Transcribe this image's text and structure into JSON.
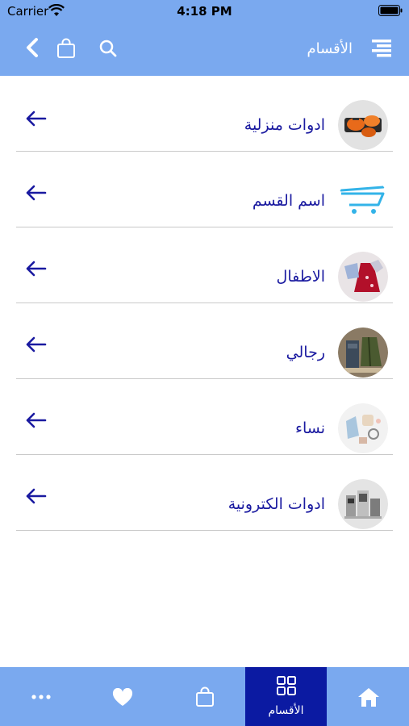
{
  "status_bar": {
    "carrier": "Carrier",
    "time": "4:18 PM"
  },
  "header": {
    "title": "الأقسام"
  },
  "categories": [
    {
      "label": "ادوات منزلية",
      "thumb": "cookware-icon"
    },
    {
      "label": "اسم القسم",
      "thumb": "cart-icon"
    },
    {
      "label": "الاطفال",
      "thumb": "kids-clothes-icon"
    },
    {
      "label": "رجالي",
      "thumb": "mens-clothes-icon"
    },
    {
      "label": "نساء",
      "thumb": "womens-items-icon"
    },
    {
      "label": "ادوات الكترونية",
      "thumb": "electronics-icon"
    }
  ],
  "tabbar": {
    "items": [
      {
        "name": "more",
        "icon": "more-icon"
      },
      {
        "name": "favorites",
        "icon": "heart-icon"
      },
      {
        "name": "cart",
        "icon": "bag-icon"
      },
      {
        "name": "categories",
        "icon": "grid-icon",
        "label": "الأقسام",
        "active": true
      },
      {
        "name": "home",
        "icon": "home-icon"
      }
    ]
  },
  "colors": {
    "header": "#7aa9ef",
    "tab_active": "#0b1aa2",
    "label": "#1a1aa0",
    "arrow": "#1a1aa0",
    "divider": "#c9c9c9"
  }
}
